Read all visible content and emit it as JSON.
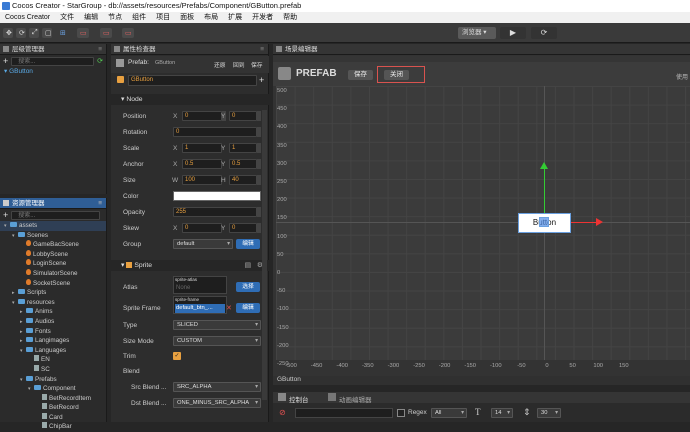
{
  "window_title": "Cocos Creator - StarGroup - db://assets/resources/Prefabs/Component/GButton.prefab",
  "menu": [
    "Cocos Creator",
    "文件",
    "编辑",
    "节点",
    "组件",
    "项目",
    "面板",
    "布局",
    "扩展",
    "开发者",
    "帮助"
  ],
  "toolbar": {
    "browser": "浏览器 ▾",
    "play": "▶",
    "refresh": "⟳"
  },
  "hierarchy": {
    "title": "层级管理器",
    "search_placeholder": "搜索...",
    "root": "GButton"
  },
  "assets": {
    "title": "资源管理器",
    "search_placeholder": "搜索...",
    "tree": [
      {
        "t": "assets",
        "d": 0,
        "k": "fold",
        "open": true
      },
      {
        "t": "Scenes",
        "d": 1,
        "k": "fold",
        "open": true
      },
      {
        "t": "GameBacScene",
        "d": 2,
        "k": "fire"
      },
      {
        "t": "LobbyScene",
        "d": 2,
        "k": "fire"
      },
      {
        "t": "LoginScene",
        "d": 2,
        "k": "fire"
      },
      {
        "t": "SimulatorScene",
        "d": 2,
        "k": "fire"
      },
      {
        "t": "SocketScene",
        "d": 2,
        "k": "fire"
      },
      {
        "t": "Scripts",
        "d": 1,
        "k": "fold",
        "open": false
      },
      {
        "t": "resources",
        "d": 1,
        "k": "fold",
        "open": true
      },
      {
        "t": "Anims",
        "d": 2,
        "k": "fold",
        "open": false
      },
      {
        "t": "Audios",
        "d": 2,
        "k": "fold",
        "open": false
      },
      {
        "t": "Fonts",
        "d": 2,
        "k": "fold",
        "open": false
      },
      {
        "t": "Langimages",
        "d": 2,
        "k": "fold",
        "open": false
      },
      {
        "t": "Languages",
        "d": 2,
        "k": "fold",
        "open": true
      },
      {
        "t": "EN",
        "d": 3,
        "k": "doc"
      },
      {
        "t": "SC",
        "d": 3,
        "k": "doc"
      },
      {
        "t": "Prefabs",
        "d": 2,
        "k": "fold",
        "open": true
      },
      {
        "t": "Component",
        "d": 3,
        "k": "fold",
        "open": true
      },
      {
        "t": "BetRecordItem",
        "d": 4,
        "k": "doc"
      },
      {
        "t": "BetRecord",
        "d": 4,
        "k": "doc"
      },
      {
        "t": "Card",
        "d": 4,
        "k": "doc"
      },
      {
        "t": "ChipBar",
        "d": 4,
        "k": "doc"
      }
    ]
  },
  "inspector": {
    "title": "属性检查器",
    "prefab_label": "Prefab:",
    "prefab_name": "GButton",
    "apply": "还原",
    "goto": "回到",
    "save": "保存",
    "node_name": "GButton",
    "section_node": "Node",
    "position": {
      "label": "Position",
      "x": "0",
      "y": "0"
    },
    "rotation": {
      "label": "Rotation",
      "v": "0"
    },
    "scale": {
      "label": "Scale",
      "x": "1",
      "y": "1"
    },
    "anchor": {
      "label": "Anchor",
      "x": "0.5",
      "y": "0.5"
    },
    "size": {
      "label": "Size",
      "w": "100",
      "h": "40"
    },
    "color": {
      "label": "Color",
      "value": "#ffffff"
    },
    "opacity": {
      "label": "Opacity",
      "v": "255"
    },
    "skew": {
      "label": "Skew",
      "x": "0",
      "y": "0"
    },
    "group": {
      "label": "Group",
      "v": "default",
      "btn": "编辑"
    },
    "section_sprite": "Sprite",
    "atlas": {
      "label": "Atlas",
      "tag": "sprite-atlas",
      "v": "None",
      "btn": "选择"
    },
    "sprite_frame": {
      "label": "Sprite Frame",
      "tag": "sprite-frame",
      "v": "default_btn_...",
      "btn": "编辑"
    },
    "type": {
      "label": "Type",
      "v": "SLICED"
    },
    "size_mode": {
      "label": "Size Mode",
      "v": "CUSTOM"
    },
    "trim": {
      "label": "Trim"
    },
    "blend": {
      "label": "Blend"
    },
    "src_blend": {
      "label": "Src Blend ...",
      "v": "SRC_ALPHA"
    },
    "dst_blend": {
      "label": "Dst Blend ...",
      "v": "ONE_MINUS_SRC_ALPHA"
    }
  },
  "scene": {
    "title": "场景编辑器",
    "logo": "PREFAB",
    "save": "保存",
    "close": "关闭",
    "hint": "使用",
    "button_text": "Button",
    "node_label": "GButton",
    "y_ticks": [
      "500",
      "450",
      "400",
      "350",
      "300",
      "250",
      "200",
      "150",
      "100",
      "50",
      "0",
      "-50",
      "-100",
      "-150",
      "-200",
      "-250"
    ],
    "x_ticks": [
      "-500",
      "-450",
      "-400",
      "-350",
      "-300",
      "-250",
      "-200",
      "-150",
      "-100",
      "-50",
      "0",
      "50",
      "100",
      "150"
    ]
  },
  "console": {
    "tab1": "控制台",
    "tab2": "动画编辑器",
    "regex": "Regex",
    "level": "All",
    "font_size": "14",
    "line_height": "30"
  },
  "colors": {
    "accent": "#2f6db5",
    "highlight": "#d9534f"
  }
}
